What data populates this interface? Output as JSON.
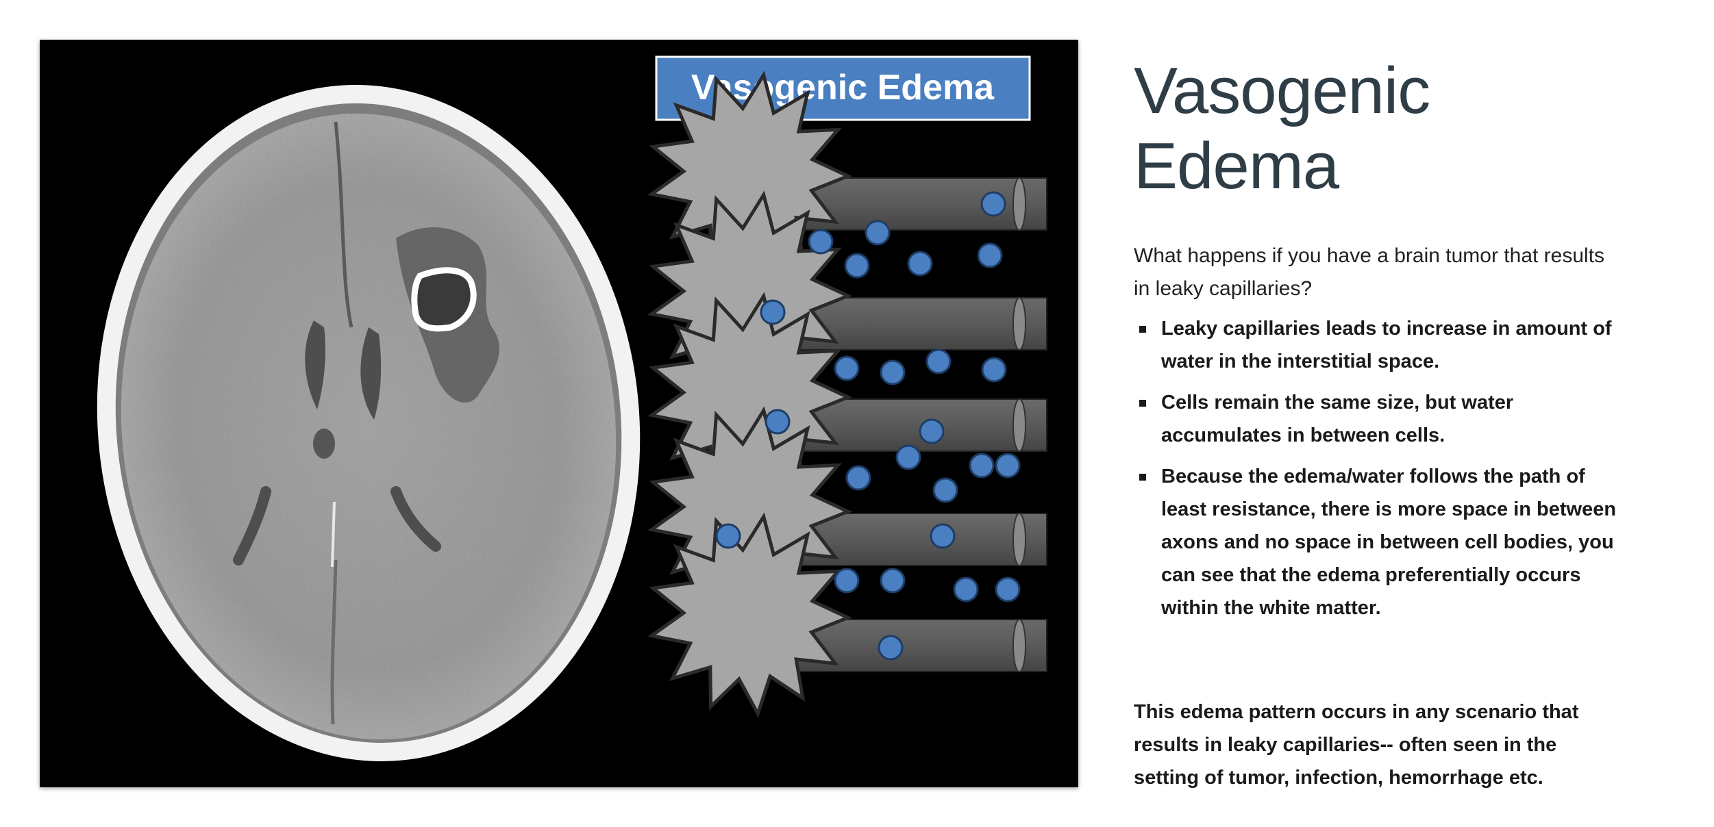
{
  "figure": {
    "label": "Vasogenic Edema",
    "colors": {
      "label_bg": "#4a7fc1",
      "cell_fill": "#a6a6a6",
      "axon_fill": "#5a5a5a",
      "water_dot": "#4a7fc1",
      "background": "#000000"
    }
  },
  "title": "Vasogenic Edema",
  "intro": "What happens if you have a brain tumor that results in leaky capillaries?",
  "bullets": [
    "Leaky capillaries leads to increase in amount of water in the interstitial space.",
    "Cells remain the same size, but water accumulates in between cells.",
    "Because the edema/water follows the path of least resistance, there is more space in between axons and no space in between cell bodies, you can see that the edema preferentially occurs within the white matter."
  ],
  "closing": "This edema pattern occurs in any scenario that results in leaky capillaries-- often seen in the setting of tumor, infection, hemorrhage etc."
}
